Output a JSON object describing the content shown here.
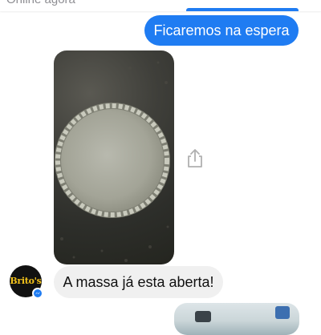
{
  "header": {
    "status": "Online agora"
  },
  "messages": [
    {
      "direction": "outgoing",
      "type": "text",
      "text": "Ficaremos na espera"
    },
    {
      "direction": "incoming",
      "type": "image",
      "description_icon": "shared-photo"
    },
    {
      "direction": "incoming",
      "type": "text",
      "text": "A massa já esta aberta!"
    },
    {
      "direction": "outgoing",
      "type": "image",
      "description_icon": "shared-photo"
    }
  ],
  "contact": {
    "avatar_text": "Brito's"
  },
  "icons": {
    "share": "share-icon",
    "badge": "messenger-icon"
  },
  "colors": {
    "outgoing_bubble": "#1f7cf2",
    "incoming_bubble": "#f0f0f0",
    "avatar_logo": "#f2c21b"
  }
}
